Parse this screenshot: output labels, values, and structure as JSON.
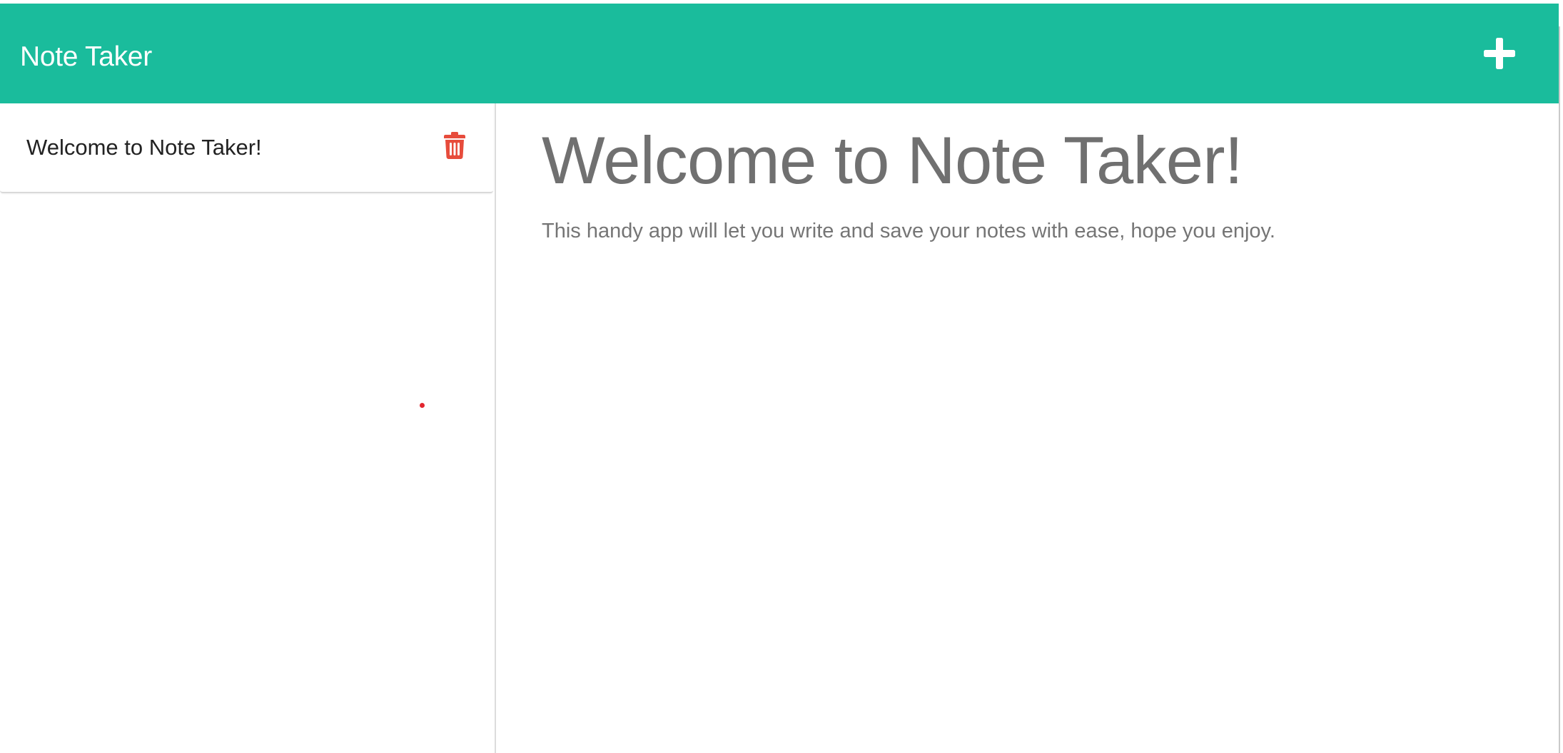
{
  "app": {
    "title": "Note Taker",
    "accent_color": "#1abc9c",
    "delete_color": "#e74c3c"
  },
  "header": {
    "brand": "Note Taker",
    "add_icon": "plus-icon"
  },
  "sidebar": {
    "notes": [
      {
        "title": "Welcome to Note Taker!",
        "delete_icon": "trash-icon"
      }
    ]
  },
  "editor": {
    "note_title": "Welcome to Note Taker!",
    "note_text": "This handy app will let you write and save your notes with ease, hope you enjoy."
  }
}
